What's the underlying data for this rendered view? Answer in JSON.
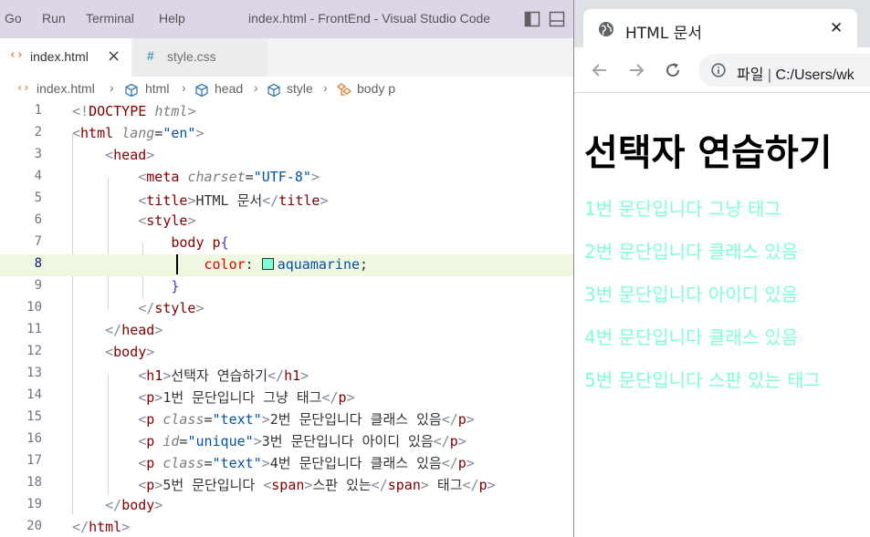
{
  "vscode": {
    "menu": [
      "Go",
      "Run",
      "Terminal",
      "Help"
    ],
    "window_title": "index.html - FrontEnd - Visual Studio Code",
    "tabs": [
      {
        "label": "index.html",
        "icon": "html-file-icon",
        "close": "×"
      },
      {
        "label": "style.css",
        "icon": "css-hash-icon",
        "glyph": "#"
      }
    ],
    "breadcrumb": [
      "index.html",
      "html",
      "head",
      "style",
      "body p"
    ],
    "code": {
      "line_numbers": [
        "1",
        "2",
        "3",
        "4",
        "5",
        "6",
        "7",
        "8",
        "9",
        "10",
        "11",
        "12",
        "13",
        "14",
        "15",
        "16",
        "17",
        "18",
        "19",
        "20"
      ],
      "l1": {
        "lt": "<!",
        "doctype": "DOCTYPE",
        "html": "html",
        "gt": ">"
      },
      "l2": {
        "lt": "<",
        "tag": "html",
        "attr": "lang",
        "eq": "=",
        "val": "\"en\"",
        "gt": ">"
      },
      "l3": {
        "lt": "<",
        "tag": "head",
        "gt": ">"
      },
      "l4": {
        "lt": "<",
        "tag": "meta",
        "attr": "charset",
        "eq": "=",
        "val": "\"UTF-8\"",
        "gt": ">"
      },
      "l5": {
        "lt": "<",
        "tag": "title",
        "gt": ">",
        "text": "HTML 문서",
        "lt2": "</",
        "tag2": "title",
        "gt2": ">"
      },
      "l6": {
        "lt": "<",
        "tag": "style",
        "gt": ">"
      },
      "l7": {
        "selector": "body p",
        "brace": "{"
      },
      "l8": {
        "prop": "color",
        "colon": ": ",
        "value": "aquamarine",
        "semi": ";"
      },
      "l9": {
        "brace": "}"
      },
      "l10": {
        "lt": "</",
        "tag": "style",
        "gt": ">"
      },
      "l11": {
        "lt": "</",
        "tag": "head",
        "gt": ">"
      },
      "l12": {
        "lt": "<",
        "tag": "body",
        "gt": ">"
      },
      "l13": {
        "lt": "<",
        "tag": "h1",
        "gt": ">",
        "text": "선택자 연습하기",
        "lt2": "</",
        "tag2": "h1",
        "gt2": ">"
      },
      "l14": {
        "lt": "<",
        "tag": "p",
        "gt": ">",
        "text": "1번 문단입니다 그냥 태그",
        "lt2": "</",
        "tag2": "p",
        "gt2": ">"
      },
      "l15": {
        "lt": "<",
        "tag": "p",
        "attr": "class",
        "eq": "=",
        "val": "\"text\"",
        "gt": ">",
        "text": "2번 문단입니다 클래스 있음",
        "lt2": "</",
        "tag2": "p",
        "gt2": ">"
      },
      "l16": {
        "lt": "<",
        "tag": "p",
        "attr": "id",
        "eq": "=",
        "val": "\"unique\"",
        "gt": ">",
        "text": "3번 문단입니다 아이디 있음",
        "lt2": "</",
        "tag2": "p",
        "gt2": ">"
      },
      "l17": {
        "lt": "<",
        "tag": "p",
        "attr": "class",
        "eq": "=",
        "val": "\"text\"",
        "gt": ">",
        "text": "4번 문단입니다 클래스 있음",
        "lt2": "</",
        "tag2": "p",
        "gt2": ">"
      },
      "l18": {
        "lt": "<",
        "tag": "p",
        "gt": ">",
        "text": "5번 문단입니다 ",
        "lt_span": "<",
        "span": "span",
        "gt_span": ">",
        "span_text": "스판 있는",
        "lt_span2": "</",
        "span2": "span",
        "gt_span2": ">",
        "text2": " 태그",
        "lt2": "</",
        "tag2": "p",
        "gt2": ">"
      },
      "l19": {
        "lt": "</",
        "tag": "body",
        "gt": ">"
      },
      "l20": {
        "lt": "</",
        "tag": "html",
        "gt": ">"
      }
    },
    "colors": {
      "tag": "#800000",
      "attr_value": "#0451a5",
      "swatch": "#7fffd4",
      "title_bar": "#ddd6e6",
      "active_line": "#eef7df"
    }
  },
  "chrome": {
    "tab_title": "HTML 문서",
    "tab_close": "✕",
    "tab_icon": "globe-icon",
    "address": {
      "prefix": "파일",
      "divider": "|",
      "url": "C:/Users/wk"
    },
    "page": {
      "h1": "선택자 연습하기",
      "paragraphs": [
        "1번 문단입니다 그냥 태그",
        "2번 문단입니다 클래스 있음",
        "3번 문단입니다 아이디 있음",
        "4번 문단입니다 클래스 있음",
        "5번 문단입니다 스판 있는 태그"
      ],
      "paragraph_color": "#7fffd4"
    }
  }
}
